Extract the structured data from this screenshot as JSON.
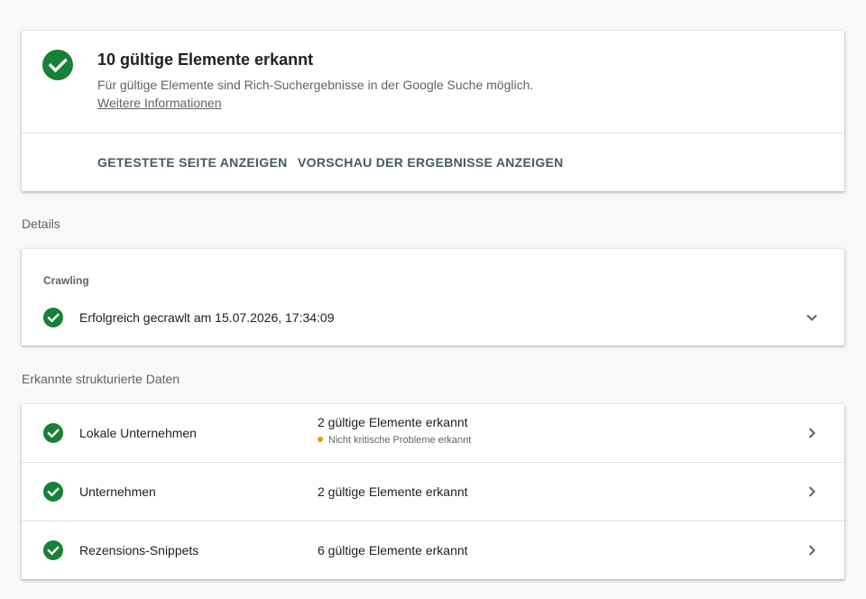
{
  "colors": {
    "success": "#188038",
    "warning": "#f29900",
    "action": "#455a64"
  },
  "summary": {
    "icon": "check-circle-icon",
    "title": "10 gültige Elemente erkannt",
    "description": "Für gültige Elemente sind Rich-Suchergebnisse in der Google Suche möglich.",
    "link": "Weitere Informationen",
    "actions": {
      "tested_page": "GETESTETE SEITE ANZEIGEN",
      "preview": "VORSCHAU DER ERGEBNISSE ANZEIGEN"
    }
  },
  "details": {
    "heading": "Details",
    "crawling": {
      "label": "Crawling",
      "status_icon": "check-circle-icon",
      "text": "Erfolgreich gecrawlt am 15.07.2026, 17:34:09",
      "expand_icon": "chevron-down-icon"
    }
  },
  "structured_data": {
    "heading": "Erkannte strukturierte Daten",
    "items": [
      {
        "name": "Lokale Unternehmen",
        "count": "2 gültige Elemente erkannt",
        "warning": "Nicht kritische Probleme erkannt"
      },
      {
        "name": "Unternehmen",
        "count": "2 gültige Elemente erkannt"
      },
      {
        "name": "Rezensions-Snippets",
        "count": "6 gültige Elemente erkannt"
      }
    ]
  }
}
